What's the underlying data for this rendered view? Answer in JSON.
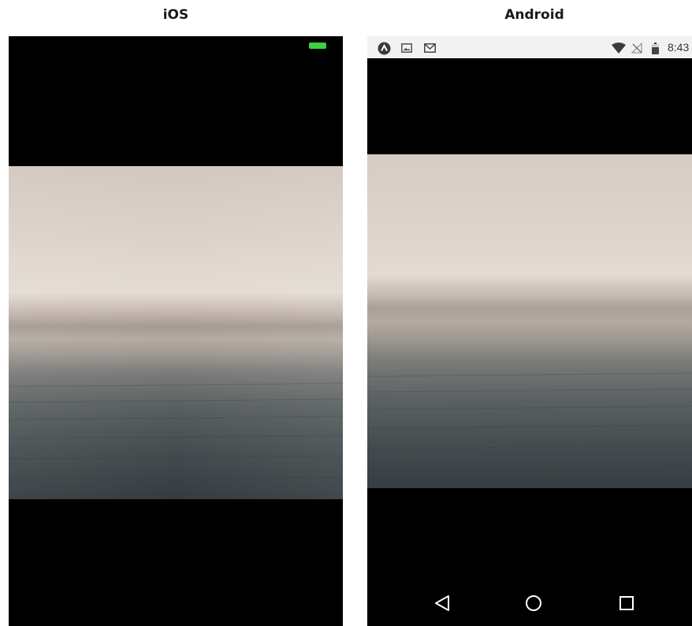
{
  "titles": {
    "ios": "iOS",
    "android": "Android"
  },
  "ios": {
    "status_bar": {
      "battery_color": "#3dd13d"
    }
  },
  "android": {
    "status_bar": {
      "time": "8:43",
      "left_icons": [
        "app-notification-icon",
        "image-notification-icon",
        "gmail-notification-icon"
      ],
      "right_icons": [
        "wifi-icon",
        "no-signal-icon",
        "battery-icon"
      ]
    },
    "nav_bar": {
      "buttons": [
        "back-button",
        "home-button",
        "recents-button"
      ]
    }
  },
  "colors": {
    "background": "#ffffff",
    "screen": "#000000",
    "status_bar_android": "#f2f2f2",
    "icon_dark": "#444444",
    "nav_icon": "#ffffff",
    "sky": "#d9cfc6",
    "sea": "#3a4145"
  }
}
